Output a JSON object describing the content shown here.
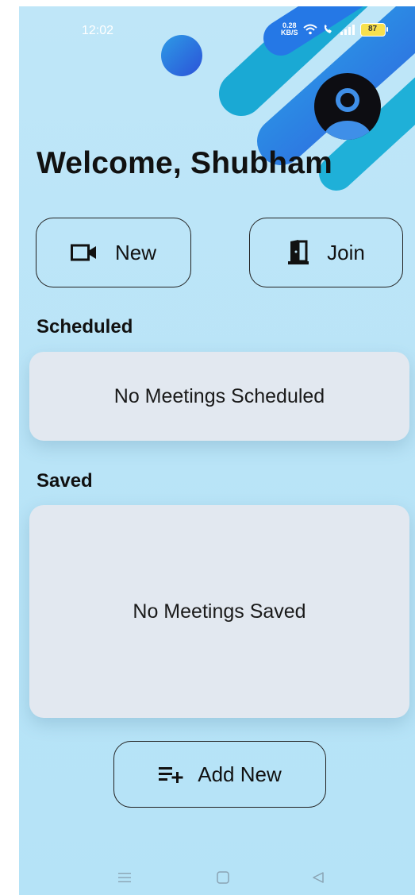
{
  "status_bar": {
    "time": "12:02",
    "net_speed_value": "0.28",
    "net_speed_unit": "KB/S",
    "battery": "87"
  },
  "header": {
    "welcome": "Welcome, Shubham"
  },
  "actions": {
    "new_label": "New",
    "join_label": "Join"
  },
  "scheduled": {
    "title": "Scheduled",
    "empty_text": "No Meetings Scheduled"
  },
  "saved": {
    "title": "Saved",
    "empty_text": "No Meetings Saved"
  },
  "add_new_label": "Add New",
  "colors": {
    "background": "#bfe6f8",
    "card": "#e2e8f0",
    "accent_blue": "#2f6fe8",
    "accent_teal": "#19b3d6"
  },
  "icons": [
    "video-camera-icon",
    "door-icon",
    "playlist-add-icon",
    "user-avatar-icon",
    "menu-icon",
    "home-square-icon",
    "back-triangle-icon"
  ]
}
